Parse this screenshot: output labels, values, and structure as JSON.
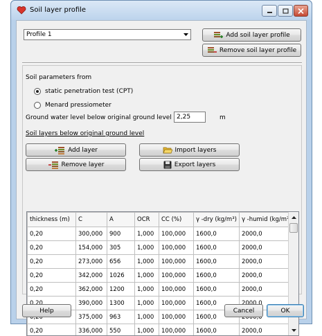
{
  "window": {
    "title": "Soil layer profile"
  },
  "profile": {
    "selected": "Profile 1",
    "add_label": "Add soil layer profile",
    "remove_label": "Remove soil layer profile"
  },
  "soil_params": {
    "heading": "Soil parameters from",
    "option_cpt": "static penetration test (CPT)",
    "option_menard": "Menard pressiometer",
    "selected_option": "static penetration test (CPT)"
  },
  "groundwater": {
    "label": "Ground water level below original ground level",
    "value": "2,25",
    "unit": "m"
  },
  "layers_section": {
    "heading": "Soil layers below original ground level",
    "add_layer": "Add layer",
    "remove_layer": "Remove layer",
    "import_layers": "Import layers",
    "export_layers": "Export layers"
  },
  "table": {
    "columns": [
      "thickness (m)",
      "C",
      "A",
      "OCR",
      "CC (%)",
      "γ -dry (kg/m³)",
      "γ -humid (kg/m³)"
    ],
    "rows": [
      [
        "0,20",
        "300,000",
        "900",
        "1,000",
        "100,000",
        "1600,0",
        "2000,0"
      ],
      [
        "0,20",
        "154,000",
        "305",
        "1,000",
        "100,000",
        "1600,0",
        "2000,0"
      ],
      [
        "0,20",
        "273,000",
        "656",
        "1,000",
        "100,000",
        "1600,0",
        "2000,0"
      ],
      [
        "0,20",
        "342,000",
        "1026",
        "1,000",
        "100,000",
        "1600,0",
        "2000,0"
      ],
      [
        "0,20",
        "362,000",
        "1200",
        "1,000",
        "100,000",
        "1600,0",
        "2000,0"
      ],
      [
        "0,20",
        "390,000",
        "1300",
        "1,000",
        "100,000",
        "1600,0",
        "2000,0"
      ],
      [
        "0,20",
        "375,000",
        "963",
        "1,000",
        "100,000",
        "1600,0",
        "2000,0"
      ],
      [
        "0,20",
        "336,000",
        "550",
        "1,000",
        "100,000",
        "1600,0",
        "2000,0"
      ]
    ]
  },
  "footer": {
    "help": "Help",
    "cancel": "Cancel",
    "ok": "OK"
  }
}
